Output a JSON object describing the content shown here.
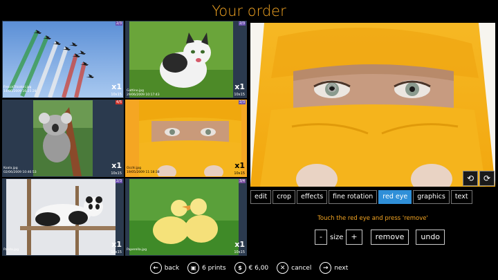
{
  "title": "Your order",
  "photos": [
    {
      "filename": "FrecceTricolori.jpg",
      "date": "14/06/2009 16:25:28",
      "badge": "2/3",
      "badge_color": "#6b4fb0",
      "qty": "x1",
      "size": "10x15"
    },
    {
      "filename": "Gattino.jpg",
      "date": "29/06/2009 10:17:43",
      "badge": "2/3",
      "badge_color": "#6b4fb0",
      "qty": "x1",
      "size": "10x15"
    },
    {
      "filename": "Koala.jpg",
      "date": "02/06/2009 10:46:53",
      "badge": "4/5",
      "badge_color": "#d0342c",
      "qty": "x1",
      "size": "10x15"
    },
    {
      "filename": "Occhi.jpg",
      "date": "19/05/2009 11:18:38",
      "badge": "2/3",
      "badge_color": "#6b4fb0",
      "qty": "x1",
      "size": "10x15"
    },
    {
      "filename": "Panda.jpg",
      "date": "",
      "badge": "2/3",
      "badge_color": "#6b4fb0",
      "qty": "x1",
      "size": "10x15"
    },
    {
      "filename": "Paperella.jpg",
      "date": "",
      "badge": "3/4",
      "badge_color": "#7a4fa0",
      "qty": "x1",
      "size": "10x15"
    }
  ],
  "tabs": [
    "edit",
    "crop",
    "effects",
    "fine rotation",
    "red eye",
    "graphics",
    "text"
  ],
  "active_tab": "red eye",
  "instruction": "Touch the red eye and press 'remove'",
  "controls": {
    "minus": "-",
    "size_label": "size",
    "plus": "+",
    "remove": "remove",
    "undo": "undo"
  },
  "bottom": {
    "back": "back",
    "prints": "6 prints",
    "price": "€ 6,00",
    "cancel": "cancel",
    "next": "next"
  },
  "colors": {
    "accent": "#f5a623",
    "active_tab": "#2f8fd8",
    "tile_bg": "#2b3a4e"
  }
}
